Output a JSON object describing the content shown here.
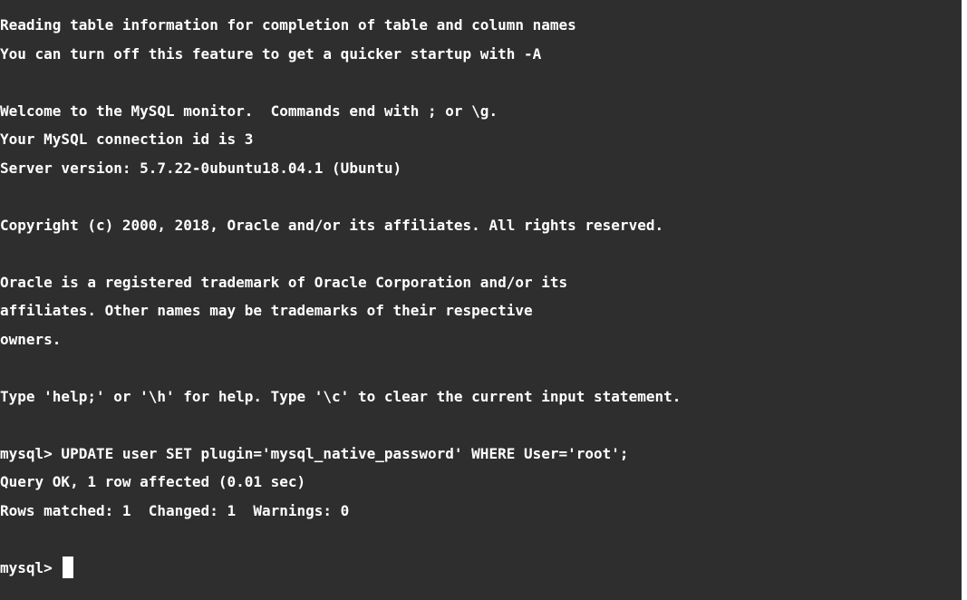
{
  "terminal": {
    "background": "#2e2e2e",
    "foreground": "#ffffff",
    "lines": [
      "Reading table information for completion of table and column names",
      "You can turn off this feature to get a quicker startup with -A",
      "",
      "Welcome to the MySQL monitor.  Commands end with ; or \\g.",
      "Your MySQL connection id is 3",
      "Server version: 5.7.22-0ubuntu18.04.1 (Ubuntu)",
      "",
      "Copyright (c) 2000, 2018, Oracle and/or its affiliates. All rights reserved.",
      "",
      "Oracle is a registered trademark of Oracle Corporation and/or its",
      "affiliates. Other names may be trademarks of their respective",
      "owners.",
      "",
      "Type 'help;' or '\\h' for help. Type '\\c' to clear the current input statement.",
      "",
      "mysql> UPDATE user SET plugin='mysql_native_password' WHERE User='root';",
      "Query OK, 1 row affected (0.01 sec)",
      "Rows matched: 1  Changed: 1  Warnings: 0",
      ""
    ],
    "prompt": "mysql> ",
    "current_input": ""
  }
}
